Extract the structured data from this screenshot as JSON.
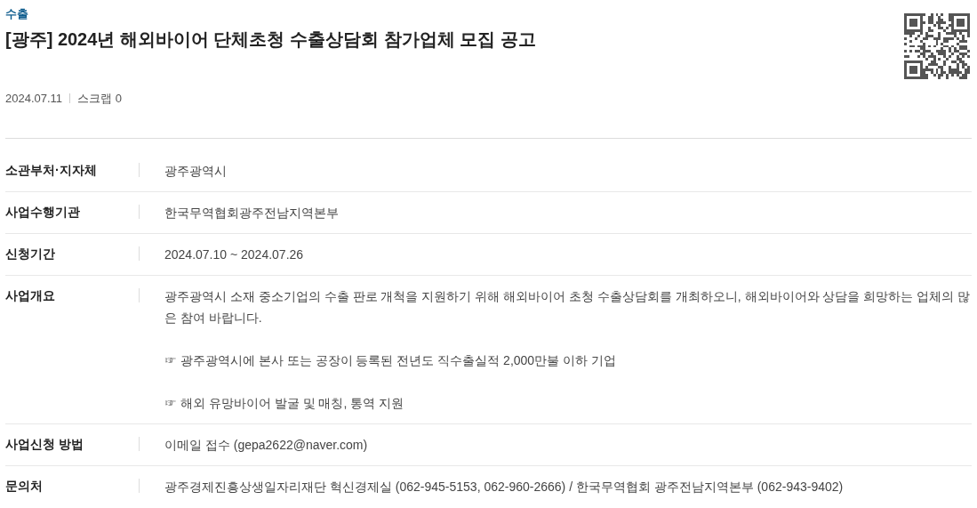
{
  "category": "수출",
  "title": "[광주] 2024년 해외바이어 단체초청 수출상담회 참가업체 모집 공고",
  "meta": {
    "date": "2024.07.11",
    "scrap": "스크랩 0"
  },
  "rows": [
    {
      "kind": "text",
      "label": "소관부처·지자체",
      "value": "광주광역시"
    },
    {
      "kind": "text",
      "label": "사업수행기관",
      "value": "한국무역협회광주전남지역본부"
    },
    {
      "kind": "text",
      "label": "신청기간",
      "value": "2024.07.10 ~ 2024.07.26"
    },
    {
      "kind": "paragraphs",
      "label": "사업개요",
      "paragraphs": [
        "광주광역시 소재 중소기업의 수출 판로 개척을 지원하기 위해 해외바이어 초청 수출상담회를 개최하오니, 해외바이어와 상담을 희망하는 업체의 많은 참여 바랍니다.",
        "☞ 광주광역시에 본사 또는 공장이 등록된 전년도 직수출실적 2,000만불 이하 기업",
        "☞ 해외 유망바이어 발굴 및 매칭, 통역 지원"
      ]
    },
    {
      "kind": "text",
      "label": "사업신청 방법",
      "value": "이메일 접수 (gepa2622@naver.com)"
    },
    {
      "kind": "text",
      "label": "문의처",
      "value": "광주경제진흥상생일자리재단 혁신경제실 (062-945-5153, 062-960-2666) / 한국무역협회 광주전남지역본부 (062-943-9402)"
    }
  ]
}
